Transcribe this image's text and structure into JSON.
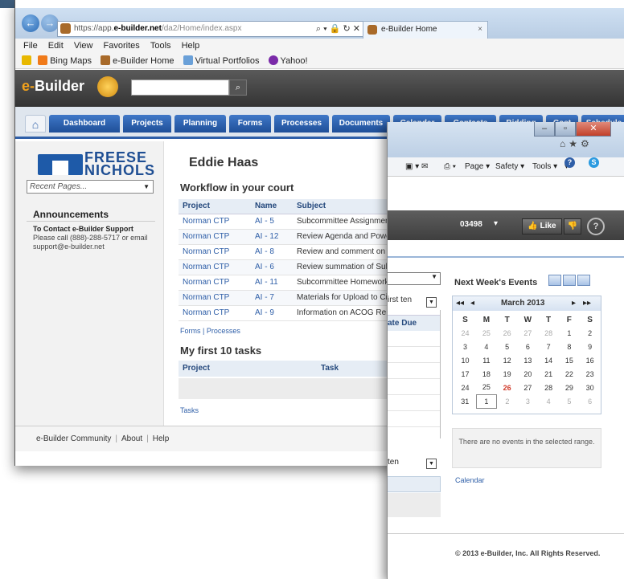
{
  "browser": {
    "url_prefix": "https://app.",
    "url_domain": "e-builder.net",
    "url_path": "/da2/Home/index.aspx",
    "address_tools": "⌕ ▾ 🔒 ↻ ✕",
    "tab_title": "e-Builder Home",
    "menu": [
      "File",
      "Edit",
      "View",
      "Favorites",
      "Tools",
      "Help"
    ],
    "favorites": [
      "Bing Maps",
      "e-Builder Home",
      "Virtual Portfolios",
      "Yahoo!"
    ]
  },
  "app": {
    "logo_e": "e-",
    "logo_rest": "Builder",
    "search_icon": "⌕",
    "nav_tabs": [
      "Dashboard",
      "Projects",
      "Planning",
      "Forms",
      "Processes",
      "Documents",
      "Calendar",
      "Contacts",
      "Bidding",
      "Cost",
      "Schedule"
    ],
    "home_icon": "home-icon"
  },
  "sidebar": {
    "logo_line1": "FREESE",
    "logo_line2": "NICHOLS",
    "recent_pages": "Recent Pages...",
    "announcements_title": "Announcements",
    "contact_title": "To Contact e-Builder Support",
    "contact_body": "Please call (888)-288-5717 or email support@e-builder.net"
  },
  "main": {
    "user_name": "Eddie Haas",
    "workflow_title": "Workflow in your court",
    "workflow_headers": [
      "Project",
      "Name",
      "Subject"
    ],
    "workflow_rows": [
      [
        "Norman CTP",
        "AI - 5",
        "Subcommittee Assignmen"
      ],
      [
        "Norman CTP",
        "AI - 12",
        "Review Agenda and Powe"
      ],
      [
        "Norman CTP",
        "AI - 8",
        "Review and comment on"
      ],
      [
        "Norman CTP",
        "AI - 6",
        "Review summation of Sub"
      ],
      [
        "Norman CTP",
        "AI - 11",
        "Subcommittee Homework"
      ],
      [
        "Norman CTP",
        "AI - 7",
        "Materials for Upload to Ci"
      ],
      [
        "Norman CTP",
        "AI - 9",
        "Information on ACOG Re"
      ]
    ],
    "workflow_links": "Forms | Processes",
    "tasks_title": "My first 10 tasks",
    "tasks_headers": [
      "Project",
      "Task"
    ],
    "tasks_link": "Tasks"
  },
  "footer": {
    "links": [
      "e-Builder Community",
      "About",
      "Help"
    ]
  },
  "front": {
    "cmd_items": [
      "Page ▾",
      "Safety ▾",
      "Tools ▾"
    ],
    "id_text": "03498",
    "like_label": "Like",
    "help_label": "?",
    "first_label": "irst ten",
    "date_due": "ate Due",
    "ten_label": "ten",
    "calendar": {
      "title": "Next Week's Events",
      "month": "March 2013",
      "weekdays": [
        "S",
        "M",
        "T",
        "W",
        "T",
        "F",
        "S"
      ],
      "weeks": [
        [
          "24",
          "25",
          "26",
          "27",
          "28",
          "1",
          "2"
        ],
        [
          "3",
          "4",
          "5",
          "6",
          "7",
          "8",
          "9"
        ],
        [
          "10",
          "11",
          "12",
          "13",
          "14",
          "15",
          "16"
        ],
        [
          "17",
          "18",
          "19",
          "20",
          "21",
          "22",
          "23"
        ],
        [
          "24",
          "25",
          "26",
          "27",
          "28",
          "29",
          "30"
        ],
        [
          "31",
          "1",
          "2",
          "3",
          "4",
          "5",
          "6"
        ]
      ],
      "today": "26",
      "no_events": "There are no events in the selected range.",
      "link": "Calendar"
    },
    "copyright": "© 2013 e-Builder, Inc. All Rights Reserved."
  },
  "colors": {
    "accent_blue": "#2f5fa8",
    "logo_orange": "#f3a21b",
    "today_red": "#d03a2a"
  }
}
